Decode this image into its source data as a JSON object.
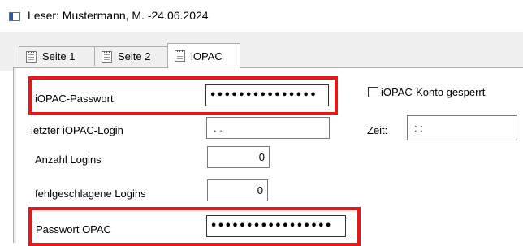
{
  "window": {
    "title": "Leser: Mustermann, M. -24.06.2024"
  },
  "tabs": [
    {
      "label": "Seite 1"
    },
    {
      "label": "Seite 2"
    },
    {
      "label": "iOPAC"
    }
  ],
  "form": {
    "iopac_password": {
      "label": "iOPAC-Passwort",
      "value": "•••••••••••••••"
    },
    "account_locked": {
      "label": "iOPAC-Konto gesperrt",
      "checked": false
    },
    "last_login": {
      "label": "letzter iOPAC-Login",
      "value": ". ."
    },
    "time": {
      "label": "Zeit:",
      "value": ": :"
    },
    "login_count": {
      "label": "Anzahl Logins",
      "value": "0"
    },
    "failed_logins": {
      "label": "fehlgeschlagene Logins",
      "value": "0"
    },
    "opac_password": {
      "label": "Passwort OPAC",
      "value": "•••••••••••••••••"
    }
  },
  "highlight_color": "#e8151b"
}
